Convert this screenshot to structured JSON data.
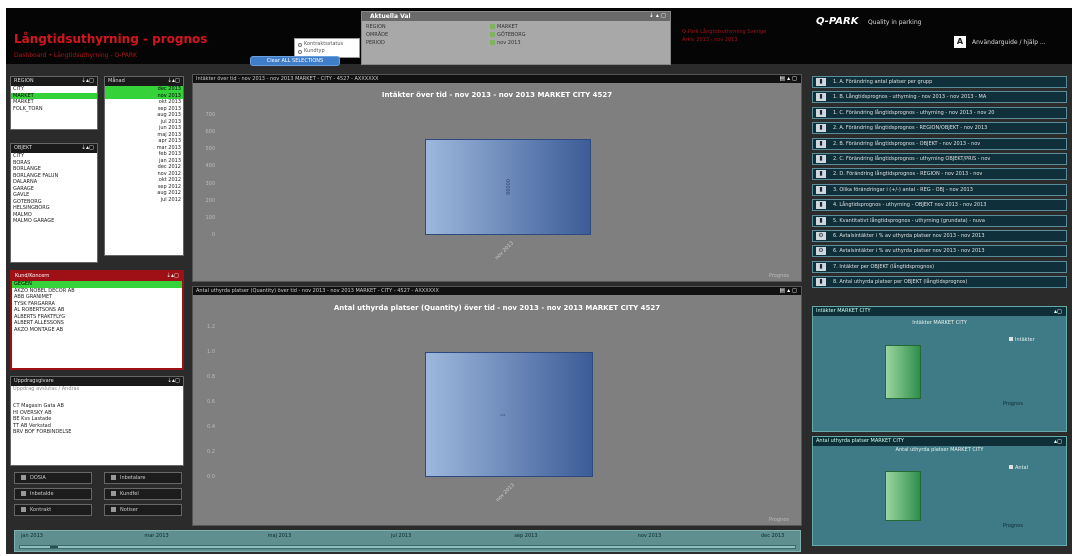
{
  "header": {
    "title": "Långtidsuthyrning - prognos",
    "subtitle": "Dashboard • Långtidsuthyrning - Q-PARK",
    "view_options": [
      "Kontraktsstatus",
      "Kundtyp"
    ],
    "clear_button": "Clear ALL SELECTIONS",
    "current_selections": {
      "title": "Aktuella Val",
      "controls": "⇣ ▴ ◻",
      "rows": [
        {
          "field": "REGION",
          "value": "MARKET"
        },
        {
          "field": "OMRÅDE",
          "value": "GÖTEBORG"
        },
        {
          "field": "PERIOD",
          "value": "nov 2013"
        }
      ]
    },
    "red_lines": [
      "Q-Park Långtidsuthyrning Sverige",
      "Arkiv 2013 - nov 2013"
    ],
    "brand": "Q-PARK",
    "brand_tagline": "Quality in parking",
    "help_icon": "A",
    "help_text": "Användarguide / hjälp ..."
  },
  "listboxes": {
    "region": {
      "caption": "REGION",
      "items": [
        "CITY",
        "MARKET",
        "MARKET",
        "FOLK_TORN"
      ],
      "selected": [
        1
      ]
    },
    "period": {
      "caption": "Månad",
      "items": [
        "dec 2013",
        "nov 2013",
        "okt 2013",
        "sep 2013",
        "aug 2013",
        "jul 2013",
        "jun 2013",
        "maj 2013",
        "apr 2013",
        "mar 2013",
        "feb 2013",
        "jan 2013",
        "dec 2012",
        "nov 2012",
        "okt 2012",
        "sep 2012",
        "aug 2012",
        "jul 2012"
      ],
      "selected": [
        0,
        1
      ]
    },
    "objekt": {
      "caption": "OBJEKT",
      "items": [
        "CITY",
        "BORÅS",
        "BORLÄNGE",
        "BORLÄNGE FALUN",
        "DALARNA",
        "GARAGE",
        "GÄVLE",
        "GÖTEBORG",
        "HELSINGBORG",
        "MALMÖ",
        "MALMÖ GARAGE"
      ]
    },
    "kunder": {
      "caption": "Kund/Koncern",
      "items": [
        "GEGEN",
        "AKZO NOBEL DECOR AB",
        "ABB GRANIMET",
        "TYSK FÄRGÄRRA",
        "AL ROBERTSONS AB",
        "ALBERTS FRAKTFLYG",
        "ALBERT ALLESSONS",
        "AKZO MONTAGE AB"
      ],
      "selected": [
        0
      ]
    },
    "uppdrag": {
      "caption": "Uppdragsgivare",
      "note": "Uppdrag avslutas / Ändras",
      "items": [
        "CT Magasin Gata AB",
        "HI ÖVERSKY AB",
        "BE Kvs Lastade",
        "TT AB Verkstad",
        "BRV BOF FÖRBINDELSE"
      ]
    }
  },
  "small_buttons": [
    {
      "label": "DOSIA",
      "col": 0
    },
    {
      "label": "Inbetalare",
      "col": 1
    },
    {
      "label": "Inbetalde",
      "col": 0
    },
    {
      "label": "Kundfel",
      "col": 1
    },
    {
      "label": "Kontrakt",
      "col": 0
    },
    {
      "label": "Notiser",
      "col": 1
    }
  ],
  "charts": [
    {
      "caption": "Intäkter över tid - nov 2013 - nov 2013 MARKET - CITY - 4527 - AXXXXXX",
      "controls": "▤ ▴ ◻",
      "footer": "Prognos",
      "chart_data": {
        "type": "bar",
        "title": "Intäkter över tid - nov 2013 - nov 2013  MARKET  CITY  4527",
        "categories": [
          "nov 2013"
        ],
        "values": [
          96
        ],
        "ylim": [
          0,
          120
        ],
        "yticks": [
          "700",
          "600",
          "500",
          "400",
          "300",
          "200",
          "100",
          "0"
        ],
        "bar_label": "96000"
      }
    },
    {
      "caption": "Antal uthyrda platser (Quantity) över tid - nov 2013 - nov 2013 MARKET - CITY - 4527 - AXXXXXX",
      "controls": "▤ ▴ ◻",
      "footer": "Prognos",
      "chart_data": {
        "type": "bar",
        "title": "Antal uthyrda platser (Quantity) över tid - nov 2013 - nov 2013  MARKET  CITY  4527",
        "categories": [
          "nov 2013"
        ],
        "values": [
          1
        ],
        "ylim": [
          0,
          1.2
        ],
        "yticks": [
          "1.2",
          "1.0",
          "0.8",
          "0.6",
          "0.4",
          "0.2",
          "0.0"
        ],
        "bar_label": "1"
      }
    }
  ],
  "right_buttons": [
    {
      "icon": "chart-icon",
      "label": "1. A. Förändring antal platser per grupp"
    },
    {
      "icon": "chart-icon",
      "label": "1. B. Långtidsprognos - uthyrning - nov 2013 - nov 2013 - MA"
    },
    {
      "icon": "chart-icon",
      "label": "1. C. Förändring långtidsprognos - uthyrning - nov 2013 - nov 20"
    },
    {
      "icon": "chart-icon",
      "label": "2. A. Förändring långtidsprognos - REGION/OBJEKT - nov 2013"
    },
    {
      "icon": "chart-icon",
      "label": "2. B. Förändring långtidsprognos - OBJEKT - nov 2013 - nov"
    },
    {
      "icon": "chart-icon",
      "label": "2. C. Förändring långtidsprognos - uthyrning OBJEKT/PRIS - nov"
    },
    {
      "icon": "chart-icon",
      "label": "2. D. Förändring långtidsprognos - REGION - nov 2013 - nov"
    },
    {
      "icon": "chart-icon",
      "label": "3. Olika förändringar i (+/-) antal - REG - OBJ - nov 2013"
    },
    {
      "icon": "chart-icon",
      "label": "4. Långtidsprognos - uthyrning - OBJEKT nov 2013 - nov 2013"
    },
    {
      "icon": "chart-icon",
      "label": "5. Kvantitativt långtidsprognos - uthyrning (grundata) - nuva"
    },
    {
      "icon": "settings-icon",
      "label": "6. Avtalsintäkter i % av uthyrda platser nov 2013 - nov 2013"
    },
    {
      "icon": "settings-icon",
      "label": "6. Avtalsintäkter i % av uthyrda platser nov 2013 - nov 2013"
    },
    {
      "icon": "chart-icon",
      "label": "7. Intäkter per OBJEKT (långtidsprognos)"
    },
    {
      "icon": "chart-icon",
      "label": "8. Antal uthyrda platser per OBJEKT (långtidsprognos)"
    }
  ],
  "mini_charts": [
    {
      "caption": "Intäkter MARKET CITY",
      "title": "Intäkter MARKET CITY",
      "legend": "Intäkter",
      "footer": "Prognos",
      "chart_data": {
        "type": "bar",
        "categories": [
          "nov 2013"
        ],
        "values": [
          1
        ]
      }
    },
    {
      "caption": "Antal uthyrda platser MARKET CITY",
      "title": "Antal uthyrda platser MARKET CITY",
      "legend": "Antal",
      "footer": "Prognos",
      "chart_data": {
        "type": "bar",
        "categories": [
          "nov 2013"
        ],
        "values": [
          1
        ]
      }
    }
  ],
  "timeline": {
    "labels": [
      "jan 2013",
      "mar 2013",
      "maj 2013",
      "jul 2013",
      "sep 2013",
      "nov 2013",
      "dec 2013"
    ]
  }
}
